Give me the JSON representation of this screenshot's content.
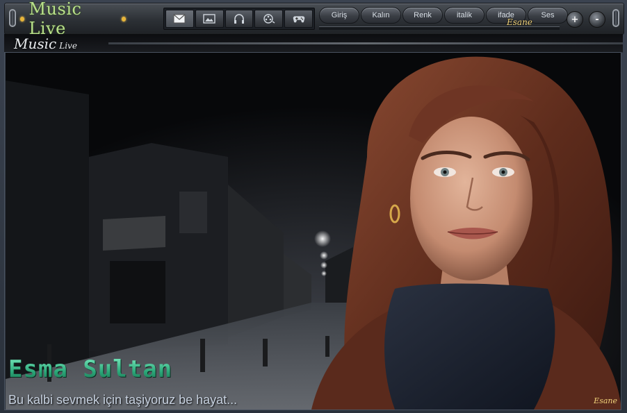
{
  "app": {
    "logo_text": "Music Live",
    "sub_logo_main": "Music",
    "sub_logo_small": "Live"
  },
  "toolbar": {
    "icons": [
      {
        "name": "mail-icon",
        "glyph": "✉"
      },
      {
        "name": "image-icon",
        "glyph": "🖼"
      },
      {
        "name": "headphones-icon",
        "glyph": "🎧"
      },
      {
        "name": "film-reel-icon",
        "glyph": "🎞"
      },
      {
        "name": "gamepad-icon",
        "glyph": "🎮"
      }
    ],
    "pills": [
      "Giriş",
      "Kalın",
      "Renk",
      "italik",
      "ifade",
      "Ses"
    ],
    "signature": "Esane",
    "zoom_in": "+",
    "zoom_out": "-"
  },
  "content": {
    "title": "Esma Sultan",
    "caption": "Bu kalbi sevmek için taşiyoruz be hayat...",
    "signature": "Esane"
  },
  "colors": {
    "accent_gold": "#e8b53a",
    "logo_green": "#b8e08a",
    "title_green": "#3fc79a"
  }
}
